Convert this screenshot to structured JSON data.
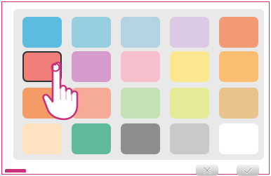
{
  "palette": {
    "selected_index": 5,
    "swatches": [
      {
        "color": "#5bbce0"
      },
      {
        "color": "#98cfe0"
      },
      {
        "color": "#b3d3e3"
      },
      {
        "color": "#dcc9e3"
      },
      {
        "color": "#f29a76"
      },
      {
        "color": "#ef7f78"
      },
      {
        "color": "#d59bcb"
      },
      {
        "color": "#f5bfcb"
      },
      {
        "color": "#fbe78f"
      },
      {
        "color": "#fbbd72"
      },
      {
        "color": "#f39c66"
      },
      {
        "color": "#f5ab96"
      },
      {
        "color": "#c4e2b3"
      },
      {
        "color": "#e5eb97"
      },
      {
        "color": "#e8c38e"
      },
      {
        "color": "#ffe2c0"
      },
      {
        "color": "#5fb99c"
      },
      {
        "color": "#8e8e8e"
      },
      {
        "color": "#c9c9c9"
      },
      {
        "color": "#ffffff"
      }
    ]
  },
  "controls": {
    "cancel_icon": "close-icon",
    "confirm_icon": "checkmark-icon"
  },
  "accent_color": "#c8327d"
}
